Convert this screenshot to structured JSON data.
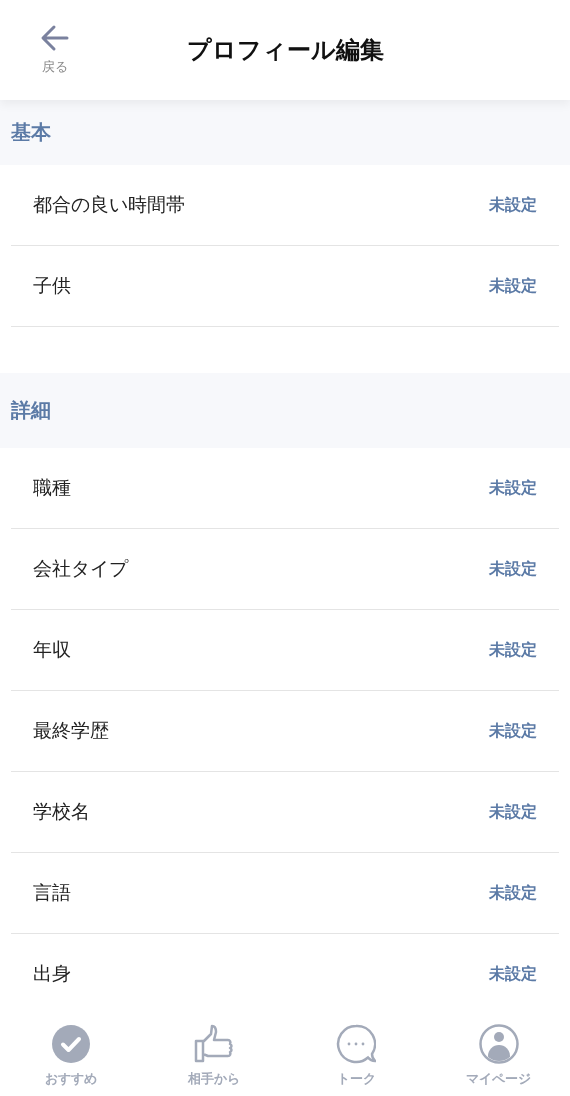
{
  "header": {
    "back_label": "戻る",
    "title": "プロフィール編集"
  },
  "sections": [
    {
      "title": "基本",
      "rows": [
        {
          "label": "都合の良い時間帯",
          "value": "未設定"
        },
        {
          "label": "子供",
          "value": "未設定"
        }
      ]
    },
    {
      "title": "詳細",
      "rows": [
        {
          "label": "職種",
          "value": "未設定"
        },
        {
          "label": "会社タイプ",
          "value": "未設定"
        },
        {
          "label": "年収",
          "value": "未設定"
        },
        {
          "label": "最終学歴",
          "value": "未設定"
        },
        {
          "label": "学校名",
          "value": "未設定"
        },
        {
          "label": "言語",
          "value": "未設定"
        },
        {
          "label": "出身",
          "value": "未設定"
        }
      ]
    }
  ],
  "tab_bar": [
    {
      "kind": "check",
      "label": "おすすめ"
    },
    {
      "kind": "thumb",
      "label": "相手から"
    },
    {
      "kind": "chat",
      "label": "トーク"
    },
    {
      "kind": "person",
      "label": "マイページ"
    }
  ]
}
